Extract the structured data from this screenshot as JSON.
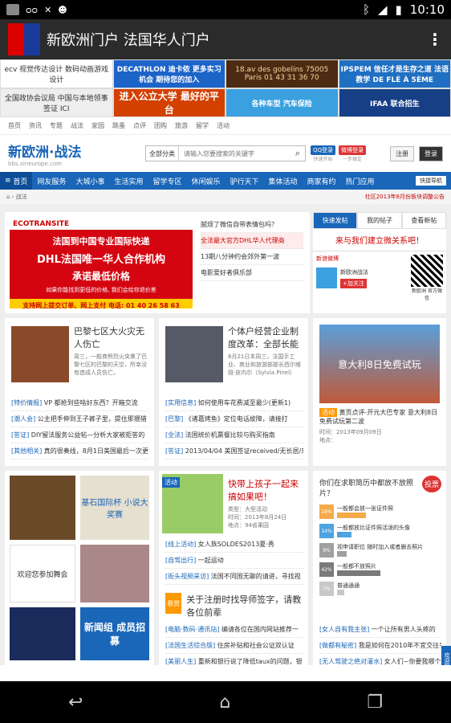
{
  "status_bar": {
    "time": "10:10"
  },
  "app": {
    "title": "新欧洲门户 法国华人门户"
  },
  "ads": [
    "ecv 视觉传达设计 数码动画游戏设计",
    "DECATHLON 迪卡侬 更多实习机会 期待您的加入",
    "18.av des gobelins 75005 Paris 01 43 31 36 70",
    "IPSPEM 信任才是生存之道 法语教学 DE FLÉ À 5ÈME",
    "全国政协会议局 中国与本地领事签证 ICI",
    "进入公立大学 最好的平台",
    "各种车型 汽车保险",
    "IFAA 联合招生"
  ],
  "topnav": [
    "首页",
    "资讯",
    "专题",
    "战法",
    "家园",
    "跳蚤",
    "点评",
    "团购",
    "旅游",
    "留学",
    "活动"
  ],
  "header": {
    "logo": "新欧洲·战法",
    "logo_sub": "bbs.xineurope.com",
    "search_category": "全部分类",
    "search_placeholder": "请输入您要搜索的关键字",
    "qq_login": "QQ登录",
    "qq_sub": "快速开始",
    "weibo_login": "微博登录",
    "weibo_sub": "一步搞定",
    "register": "注册",
    "login": "登录"
  },
  "mainnav": [
    "首页",
    "网友服务",
    "大城小事",
    "生活实用",
    "留学专区",
    "休闲娱乐",
    "驴行天下",
    "集体活动",
    "商家有约",
    "热门应用"
  ],
  "quick_nav": "快捷导航",
  "breadcrumb": {
    "section": "战法",
    "notice": "社区2013年8月份板块调整公告"
  },
  "dhl": {
    "brand": "ECOTRANSITE",
    "line1": "法国到中国专业国际快递",
    "line2": "DHL法国唯一华人合作机构",
    "line3": "承诺最低价格",
    "line4": "如果你能找到更低的价格, 我们会给你退价差",
    "footer": "支持网上提交订单、网上支付   电话: 01 40 26 58 63"
  },
  "hot_list": [
    "腻烦了微信自带表情包吗？",
    "全法最大官方DHL华人代理商",
    "13期八分钟约会郊外第一波",
    "电影爱好者俱乐部"
  ],
  "right_tabs": [
    "快速发帖",
    "我的帖子",
    "查看新帖"
  ],
  "weibo": {
    "title": "来与我们建立微关系吧！",
    "name": "新欧洲战法",
    "add": "+加关注",
    "qr_label": "新欧洲 官方微信",
    "site": "新浪微博"
  },
  "news": [
    {
      "title": "巴黎七区大火灾无人伤亡",
      "desc": "周三，一般商熊烈火突熏了巴黎七区的巴黎的天空，所幸没有造成人员伤亡。"
    },
    {
      "title": "个体户经营企业制度改革：全部长能",
      "desc": "8月21日本周三，法国手工业、商业和旅游部部长西尔维娅·皮内尔（Sylvia Pinel）"
    },
    {
      "title": "黄页点评-开元大巴专家 意大利8日免费试玩第二波",
      "tag": "活动",
      "time": "时间：2013年09月09日",
      "place": "地点："
    }
  ],
  "news_links_1": [
    {
      "tag": "[特价情报]",
      "text": "VP 都抢到些啥好东西？开箱交流"
    },
    {
      "tag": "[潮人会]",
      "text": "公主把手伸到王子裤子里，提住那猥猎"
    },
    {
      "tag": "[答证]",
      "text": "DIY留法服务公益帖—分析大家被拒答的"
    },
    {
      "tag": "[其他相关]",
      "text": "真的很奏线，8月1日美国最后一次更"
    }
  ],
  "news_links_2": [
    {
      "tag": "[实用信息]",
      "text": "如何使用车花费减至最少(更新1)"
    },
    {
      "tag": "[巴黎]",
      "text": "《诸葛烤鱼》定位电话故障，请接打"
    },
    {
      "tag": "[全法]",
      "text": "法国统价机票餐比较与购买指南"
    },
    {
      "tag": "[答证]",
      "text": "2013/04/04 美国签证received/无长居/来"
    }
  ],
  "activity": {
    "label": "活动",
    "title": "快带上孩子一起来搞如果吧！",
    "type": "类型：大型活动",
    "time": "时间：2013年8月24日",
    "place": "地点：94省果园"
  },
  "activity_links": [
    {
      "tag": "[线上活动]",
      "text": "女人族SOLDES2013夏·秀"
    },
    {
      "tag": "[自驾出行]",
      "text": "一起运动"
    },
    {
      "tag": "[街头视频采访]",
      "text": "法国不同国无聊的请进，寻找视"
    }
  ],
  "hot2": {
    "label": "悬赏",
    "title": "关于注册时找导师签字，请教各位前辈"
  },
  "hot2_links": [
    {
      "tag": "[电脑·数码·通讯站]",
      "text": "编请各位在国内网站推荐一"
    },
    {
      "tag": "[法国生活综合版]",
      "text": "住房补贴和社会公证双认证"
    },
    {
      "tag": "[美丽人生]",
      "text": "重新和银行说了降低taux的问题，银"
    }
  ],
  "poll": {
    "question": "你们在求职简历中都放不放照片？",
    "badge": "投票",
    "options": [
      {
        "label": "一般都会放一张证件照",
        "pct": 0.28
      },
      {
        "label": "一般都放比证件照活泼的头像",
        "pct": 0.14
      },
      {
        "label": "视申请职位  随时加入或者删去照片",
        "pct": 0.09
      },
      {
        "label": "一般都不放照片",
        "pct": 0.42
      },
      {
        "label": "普通通通",
        "pct": 0.07
      }
    ]
  },
  "poll_links": [
    {
      "tag": "[女人自有我主张]",
      "text": "一个让所有男人头疼的"
    },
    {
      "tag": "[做都有秘密]",
      "text": "我是如何在2010年不宜交往手"
    },
    {
      "tag": "[无人驾驶之绝对灌水]",
      "text": "女人们~你要我哪个"
    }
  ],
  "photo_labels": {
    "cup": "基石国际杯 小说大奖赛",
    "recruit": "新闻组 成员招募",
    "dance": "欢迎您参加舞会"
  },
  "feedback": "欢迎提建议"
}
